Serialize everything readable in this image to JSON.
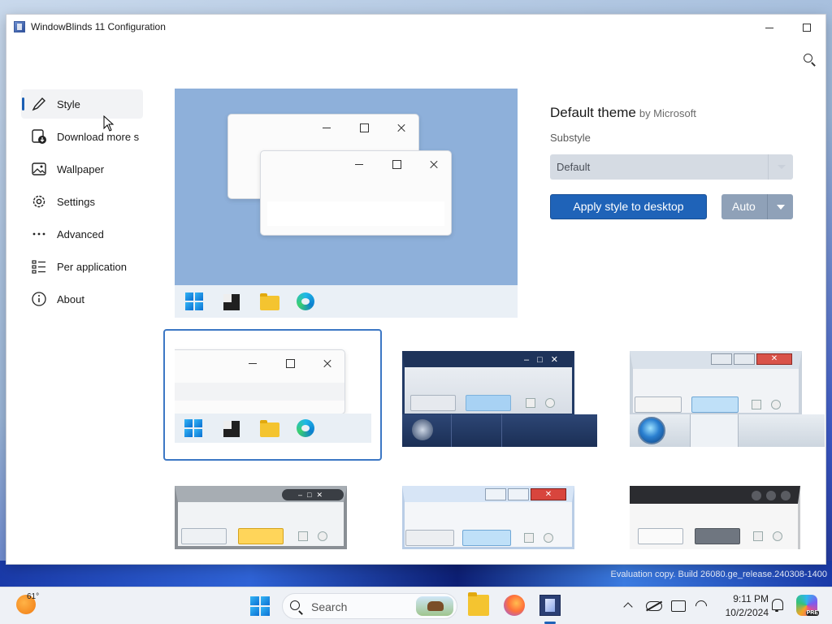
{
  "window": {
    "title": "WindowBlinds 11 Configuration"
  },
  "sidebar": {
    "items": [
      {
        "label": "Style",
        "icon": "brush-icon",
        "active": true
      },
      {
        "label": "Download more skins",
        "icon": "download-icon"
      },
      {
        "label": "Wallpaper",
        "icon": "image-icon"
      },
      {
        "label": "Settings",
        "icon": "gear-icon"
      },
      {
        "label": "Advanced",
        "icon": "more-dots-icon"
      },
      {
        "label": "Per application",
        "icon": "list-icon"
      },
      {
        "label": "About",
        "icon": "info-icon"
      }
    ]
  },
  "theme": {
    "name": "Default theme",
    "author": "by Microsoft",
    "substyle_label": "Substyle",
    "substyle_value": "Default",
    "apply_label": "Apply style to desktop",
    "auto_label": "Auto"
  },
  "taskbar": {
    "temperature": "61°",
    "search_placeholder": "Search",
    "time": "9:11 PM",
    "date": "10/2/2024"
  },
  "watermark": {
    "line1": "Evaluation copy. Build 26080.ge_release.240308-1400"
  },
  "colors": {
    "accent": "#1f63b8",
    "preview_bg": "#8eb0da",
    "auto_button": "#8fa1b8"
  }
}
